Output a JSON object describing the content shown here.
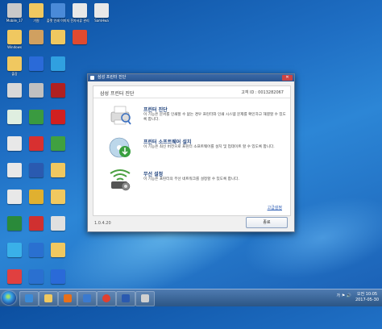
{
  "desktop": {
    "icons": [
      {
        "label": "Mobile_17",
        "color": "#c9c9c9"
      },
      {
        "label": "가원",
        "color": "#f0c860"
      },
      {
        "label": "플랫 인쇄 이미지",
        "color": "#4a8ad8"
      },
      {
        "label": "전자서류 관리",
        "color": "#e8e8e8"
      },
      {
        "label": "SamHwa",
        "color": "#e8e8e8"
      },
      {
        "label": "Windows",
        "color": "#f0c860"
      },
      {
        "label": "출장",
        "color": "#f0c860"
      },
      {
        "label": "",
        "color": "#d8d8d8"
      },
      {
        "label": "",
        "color": "#dfeee0"
      },
      {
        "label": "",
        "color": "#e8e8e8"
      },
      {
        "label": "",
        "color": "#e8e8e8"
      },
      {
        "label": "",
        "color": "#e8e8e8"
      },
      {
        "label": "",
        "color": "#2a8a3a"
      },
      {
        "label": "",
        "color": "#3ab0e8"
      },
      {
        "label": "",
        "color": "#e04040"
      },
      {
        "label": "",
        "color": "#d0a060"
      },
      {
        "label": "",
        "color": "#2a6ad8"
      },
      {
        "label": "",
        "color": "#c0c0c0"
      },
      {
        "label": "",
        "color": "#3a9a40"
      },
      {
        "label": "",
        "color": "#d83030"
      },
      {
        "label": "",
        "color": "#2a5ab0"
      },
      {
        "label": "",
        "color": "#e0b030"
      },
      {
        "label": "",
        "color": "#d03030"
      },
      {
        "label": "",
        "color": "#2a70d0"
      },
      {
        "label": "",
        "color": "#2a70d0"
      },
      {
        "label": "",
        "color": "#f0c860"
      },
      {
        "label": "",
        "color": "#30a0e0"
      },
      {
        "label": "",
        "color": "#b02020"
      },
      {
        "label": "",
        "color": "#d02020"
      },
      {
        "label": "",
        "color": "#40a040"
      },
      {
        "label": "",
        "color": "#f0c860"
      },
      {
        "label": "",
        "color": "#f0c860"
      },
      {
        "label": "",
        "color": "#e0e0e0"
      },
      {
        "label": "",
        "color": "#f0c860"
      },
      {
        "label": "",
        "color": "#2a6ad8"
      },
      {
        "label": "",
        "color": "#e04a30"
      }
    ]
  },
  "dialog": {
    "title": "삼성 프린터 진단",
    "close_label": "✕",
    "header_title": "삼성 프린터 진단",
    "customer_id": "고객 ID : 0013282067",
    "items": [
      {
        "title": "프린터 진단",
        "desc": "이 기능은 문서를 인쇄할 수 없는 경우 프린터와 인쇄 시스템 문제를 확인하고 해결할 수 있도록 합니다.",
        "icon_name": "printer-diagnose-icon"
      },
      {
        "title": "프린터 소프트웨어 설치",
        "desc": "이 기능은 최신 버전으로 프린터 소프트웨어를 설치 및 업데이트 할 수 있도록 합니다.",
        "icon_name": "software-install-icon"
      },
      {
        "title": "무선 설정",
        "desc": "이 기능은 프린터의 무선 네트워크를 설정할 수 있도록 합니다.",
        "icon_name": "wireless-setup-icon"
      }
    ],
    "advanced_link": "고급설정",
    "version": "1.0.4.20",
    "ok_label": "종료"
  },
  "taskbar": {
    "tray_text": "가 ⚑ 🔊",
    "time": "오전 10:05",
    "date": "2017-05-30"
  }
}
